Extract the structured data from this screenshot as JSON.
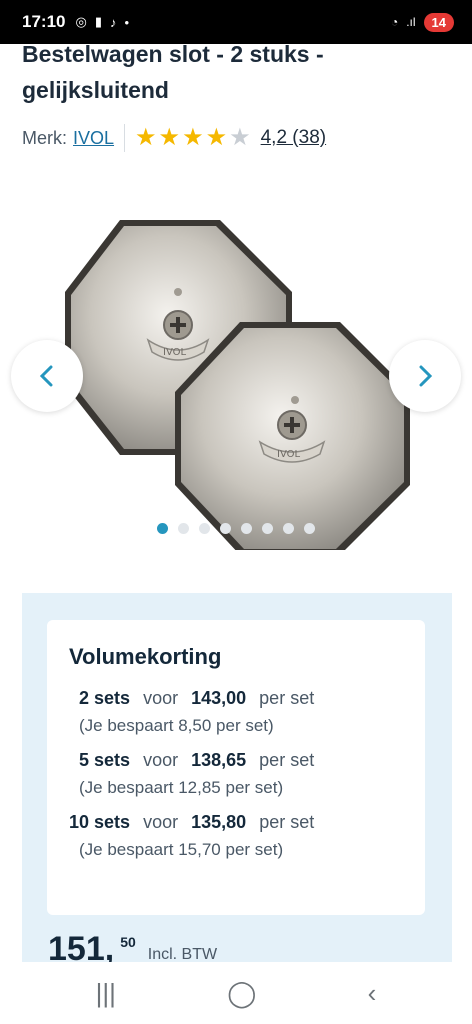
{
  "status_bar": {
    "time": "17:10",
    "battery": "14"
  },
  "product": {
    "title": "Bestelwagen slot - 2 stuks - gelijksluitend",
    "brand_label": "Merk:",
    "brand_name": "IVOL",
    "rating_value": 4.2,
    "rating_text": "4,2 (38)",
    "stars_filled": 4,
    "stars_total": 5
  },
  "gallery": {
    "image_count": 8,
    "active_index": 0,
    "image_text": "IVOL"
  },
  "volume_discount": {
    "title": "Volumekorting",
    "tiers": [
      {
        "qty": "2 sets",
        "voor": "voor",
        "price": "143,00",
        "per": "per set",
        "saving": "(Je bespaart 8,50 per set)"
      },
      {
        "qty": "5 sets",
        "voor": "voor",
        "price": "138,65",
        "per": "per set",
        "saving": "(Je bespaart 12,85 per set)"
      },
      {
        "qty": "10 sets",
        "voor": "voor",
        "price": "135,80",
        "per": "per set",
        "saving": "(Je bespaart 15,70 per set)"
      }
    ]
  },
  "price": {
    "main": "151,",
    "cents": "50",
    "vat_label": "Incl. BTW"
  },
  "colors": {
    "accent": "#2596be",
    "star": "#f5b800",
    "promo_bg": "#e4f1f9"
  }
}
